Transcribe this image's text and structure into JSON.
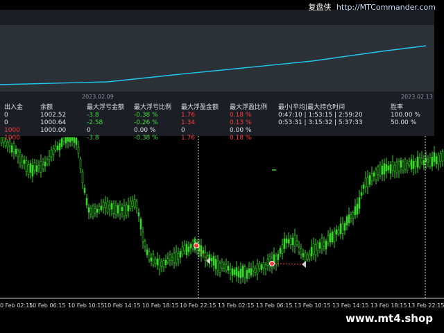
{
  "brand": {
    "name_cn": "复盘侠",
    "url": "http://MTCommander.com"
  },
  "equity_panel": {
    "date_start": "2023.02.09",
    "date_end": "2023.02.13"
  },
  "stats_table": {
    "headers": [
      "出入金",
      "余额",
      "最大浮亏金额",
      "最大浮亏比例",
      "最大浮盈金额",
      "最大浮盈比例",
      "最小|平均|最大持仓时间",
      "胜率"
    ],
    "rows": [
      [
        "0",
        "1002.52",
        "-3.8",
        "-0.38 %",
        "1.76",
        "0.18 %",
        "0:47:10 | 1:53:15 | 2:59:20",
        "100.00 %"
      ],
      [
        "0",
        "1000.64",
        "-2.58",
        "-0.26 %",
        "1.34",
        "0.13 %",
        "0:53:31 | 3:15:32 | 5:37:33",
        "50.00 %"
      ],
      [
        "1000",
        "1000.00",
        "0",
        "0.00 %",
        "0",
        "0.00 %",
        "",
        ""
      ],
      [
        "1000",
        "",
        "-3.8",
        "-0.38 %",
        "1.76",
        "0.18 %",
        "",
        ""
      ]
    ]
  },
  "x_axis": {
    "labels": [
      "0 Feb 02:15",
      "10 Feb 06:15",
      "10 Feb 10:15",
      "10 Feb 14:15",
      "10 Feb 18:15",
      "10 Feb 22:15",
      "13 Feb 02:15",
      "13 Feb 06:15",
      "13 Feb 10:15",
      "13 Feb 14:15",
      "13 Feb 18:15",
      "13 Feb 22:15"
    ]
  },
  "watermark": "www.mt4.shop",
  "colors": {
    "candle": "#39d629",
    "equity_line": "#1ec8f0",
    "panel_bg": "#1b1f25",
    "loss": "#ff3b3b",
    "gain": "#3ddc3d"
  }
}
